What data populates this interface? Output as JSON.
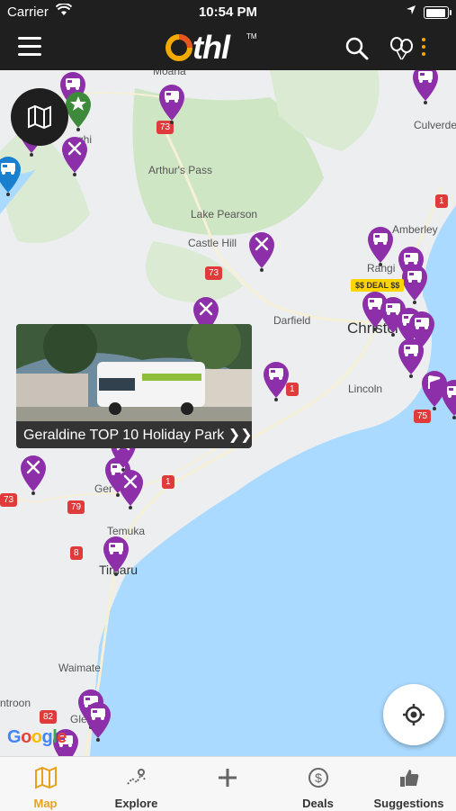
{
  "status_bar": {
    "carrier": "Carrier",
    "time": "10:54 PM"
  },
  "nav": {
    "logo_text": "thl",
    "logo_tm": "TM"
  },
  "map": {
    "places": [
      {
        "name": "Moana"
      },
      {
        "name": "Arthur's Pass"
      },
      {
        "name": "Lake Pearson"
      },
      {
        "name": "Castle Hill"
      },
      {
        "name": "Darfield"
      },
      {
        "name": "Christchurch"
      },
      {
        "name": "Lincoln"
      },
      {
        "name": "Amberley"
      },
      {
        "name": "Rangi"
      },
      {
        "name": "Culverden"
      },
      {
        "name": "Temuka"
      },
      {
        "name": "Timaru"
      },
      {
        "name": "Waimate"
      },
      {
        "name": "ntroon"
      },
      {
        "name": "Glen"
      },
      {
        "name": "Ger"
      },
      {
        "name": "ghi"
      }
    ],
    "road_shields": [
      "73",
      "73",
      "1",
      "1",
      "75",
      "79",
      "8",
      "1",
      "82",
      "73"
    ],
    "deal_tag": "$$ DEAL $$",
    "callout_title": "Geraldine TOP 10 Holiday Park",
    "callout_chevron": "❯❯",
    "google": [
      "G",
      "o",
      "o",
      "g",
      "l",
      "e"
    ],
    "pin_color": "#8c2fa9",
    "pin_blue": "#1a7fcf",
    "pin_green": "#3d8a3a"
  },
  "tabs": [
    {
      "label": "Map",
      "icon": "map-icon",
      "active": true
    },
    {
      "label": "Explore",
      "icon": "explore-icon",
      "active": false
    },
    {
      "label": "",
      "icon": "plus-icon",
      "active": false
    },
    {
      "label": "Deals",
      "icon": "dollar-icon",
      "active": false
    },
    {
      "label": "Suggestions",
      "icon": "thumbs-up-icon",
      "active": false
    }
  ],
  "colors": {
    "accent": "#e8a21a",
    "bar": "#1f1f1f",
    "sea": "#aadaff",
    "land": "#eceef0",
    "forest": "#cfe6c4"
  }
}
